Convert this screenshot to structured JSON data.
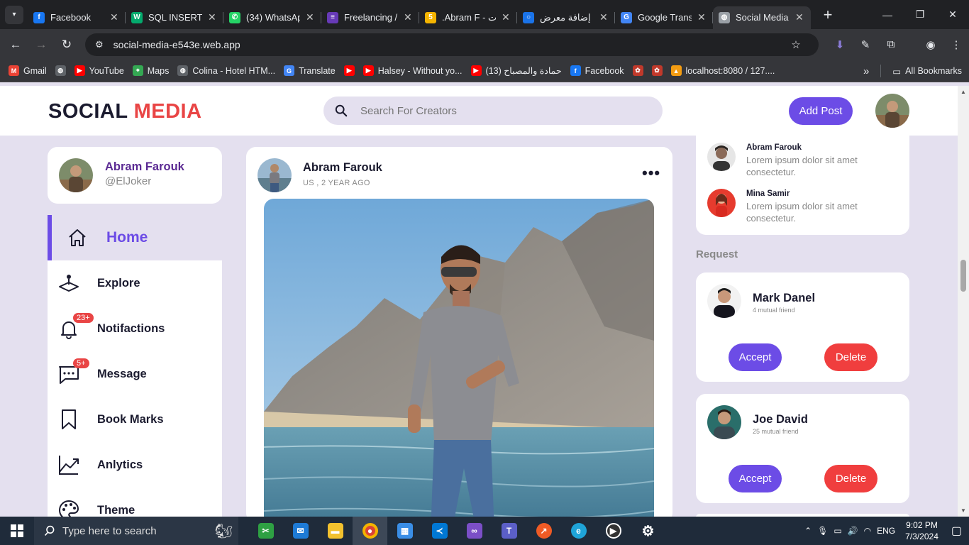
{
  "browser": {
    "tabs": [
      {
        "label": "Facebook",
        "icon": "facebook-icon",
        "color": "#1877f2",
        "glyph": "f"
      },
      {
        "label": "SQL INSERT I",
        "icon": "w3schools-icon",
        "color": "#04aa6d",
        "glyph": "W"
      },
      {
        "label": "(34) WhatsAp",
        "icon": "whatsapp-icon",
        "color": "#25d366",
        "glyph": "✆"
      },
      {
        "label": "Freelancing /",
        "icon": "forms-icon",
        "color": "#673ab7",
        "glyph": "≡"
      },
      {
        "label": ".Abram F - ت",
        "icon": "slides-icon",
        "color": "#f4b400",
        "glyph": "5"
      },
      {
        "label": "إضافة معرض",
        "icon": "circle-app-icon",
        "color": "#1a73e8",
        "glyph": "○"
      },
      {
        "label": "Google Trans",
        "icon": "google-translate-icon",
        "color": "#4285f4",
        "glyph": "G"
      },
      {
        "label": "Social Media",
        "icon": "globe-icon",
        "color": "#9aa0a6",
        "glyph": "◍"
      }
    ],
    "new_tab": "+",
    "url": "social-media-e543e.web.app",
    "bookmarks": [
      {
        "label": "Gmail",
        "icon": "gmail-icon",
        "color": "#ea4335",
        "glyph": "M"
      },
      {
        "label": "",
        "icon": "globe-icon",
        "color": "#5f6368",
        "glyph": "◍"
      },
      {
        "label": "YouTube",
        "icon": "youtube-icon",
        "color": "#ff0000",
        "glyph": "▶"
      },
      {
        "label": "Maps",
        "icon": "maps-icon",
        "color": "#34a853",
        "glyph": "⌖"
      },
      {
        "label": "Colina - Hotel HTM...",
        "icon": "globe-icon",
        "color": "#5f6368",
        "glyph": "◍"
      },
      {
        "label": "Translate",
        "icon": "google-translate-icon",
        "color": "#4285f4",
        "glyph": "G"
      },
      {
        "label": "",
        "icon": "youtube-icon",
        "color": "#ff0000",
        "glyph": "▶"
      },
      {
        "label": "Halsey - Without yo...",
        "icon": "youtube-icon",
        "color": "#ff0000",
        "glyph": "▶"
      },
      {
        "label": "حمادة والمصباح (13)",
        "icon": "youtube-icon",
        "color": "#ff0000",
        "glyph": "▶"
      },
      {
        "label": "Facebook",
        "icon": "facebook-icon",
        "color": "#1877f2",
        "glyph": "f"
      },
      {
        "label": "",
        "icon": "bookmark-app-icon",
        "color": "#c0392b",
        "glyph": "✿"
      },
      {
        "label": "",
        "icon": "bookmark-app-icon",
        "color": "#c0392b",
        "glyph": "✿"
      },
      {
        "label": "localhost:8080 / 127....",
        "icon": "phpmyadmin-icon",
        "color": "#f39c12",
        "glyph": "▲"
      }
    ],
    "all_bookmarks": "All Bookmarks"
  },
  "header": {
    "logo_part1": "SOCIAL",
    "logo_part2": "MEDIA",
    "search_placeholder": "Search For Creators",
    "add_post": "Add Post"
  },
  "profile": {
    "name": "Abram Farouk",
    "handle": "@ElJoker"
  },
  "sidebar": {
    "items": [
      {
        "label": "Home",
        "icon": "home-icon",
        "active": true
      },
      {
        "label": "Explore",
        "icon": "explore-icon"
      },
      {
        "label": "Notifactions",
        "icon": "bell-icon",
        "badge": "23+"
      },
      {
        "label": "Message",
        "icon": "message-icon",
        "badge": "5+"
      },
      {
        "label": "Book Marks",
        "icon": "bookmark-icon"
      },
      {
        "label": "Anlytics",
        "icon": "analytics-icon"
      },
      {
        "label": "Theme",
        "icon": "palette-icon"
      }
    ]
  },
  "post": {
    "author": "Abram Farouk",
    "meta": "US , 2 YEAR AGO",
    "more": "•••"
  },
  "messages": [
    {
      "name": "Abram Farouk",
      "text": "Lorem ipsum dolor sit amet consectetur."
    },
    {
      "name": "Mina Samir",
      "text": "Lorem ipsum dolor sit amet consectetur."
    }
  ],
  "requests": {
    "title": "Request",
    "items": [
      {
        "name": "Mark Danel",
        "mutual": "4 mutual friend",
        "accept": "Accept",
        "delete": "Delete"
      },
      {
        "name": "Joe David",
        "mutual": "25 mutual friend",
        "accept": "Accept",
        "delete": "Delete"
      }
    ]
  },
  "colors": {
    "accent": "#6c4ce6",
    "danger": "#f03e3e",
    "logo_red": "#e94545",
    "page_bg": "#e4e0ef"
  },
  "taskbar": {
    "search_placeholder": "Type here to search",
    "language": "ENG",
    "time": "9:02 PM",
    "date": "7/3/2024"
  }
}
